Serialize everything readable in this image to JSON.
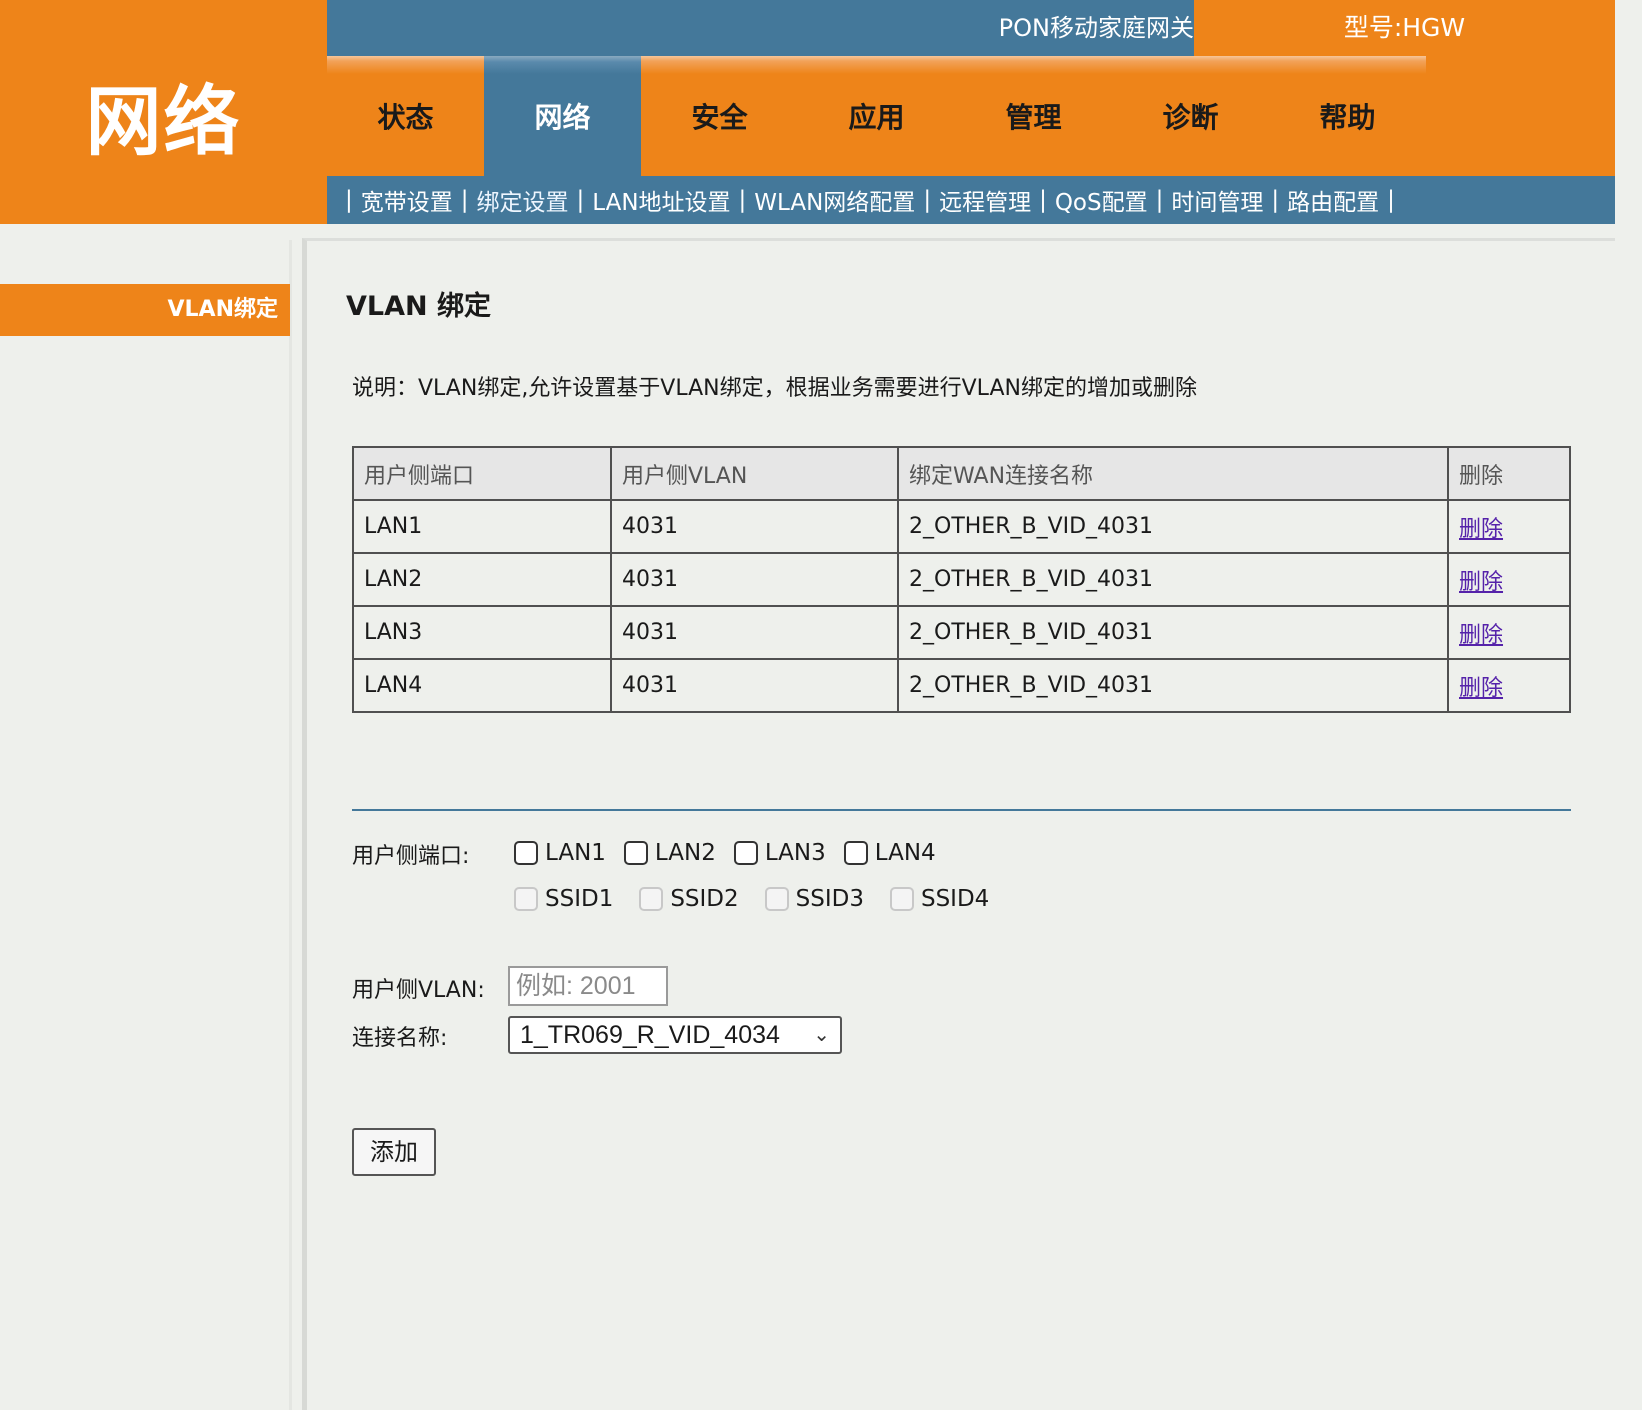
{
  "header": {
    "brand": "网络",
    "product": "PON移动家庭网关",
    "model": "型号:HGW"
  },
  "tabs": [
    {
      "label": "状态",
      "active": false
    },
    {
      "label": "网络",
      "active": true
    },
    {
      "label": "安全",
      "active": false
    },
    {
      "label": "应用",
      "active": false
    },
    {
      "label": "管理",
      "active": false
    },
    {
      "label": "诊断",
      "active": false
    },
    {
      "label": "帮助",
      "active": false
    }
  ],
  "subnav": {
    "separator": "|",
    "items": [
      "宽带设置",
      "绑定设置",
      "LAN地址设置",
      "WLAN网络配置",
      "远程管理",
      "QoS配置",
      "时间管理",
      "路由配置"
    ],
    "active_index": 1
  },
  "sidebar": {
    "items": [
      "VLAN绑定"
    ]
  },
  "main": {
    "title": "VLAN 绑定",
    "description": "说明：VLAN绑定,允许设置基于VLAN绑定，根据业务需要进行VLAN绑定的增加或删除",
    "table": {
      "headers": [
        "用户侧端口",
        "用户侧VLAN",
        "绑定WAN连接名称",
        "删除"
      ],
      "rows": [
        [
          "LAN1",
          "4031",
          "2_OTHER_B_VID_4031",
          "删除"
        ],
        [
          "LAN2",
          "4031",
          "2_OTHER_B_VID_4031",
          "删除"
        ],
        [
          "LAN3",
          "4031",
          "2_OTHER_B_VID_4031",
          "删除"
        ],
        [
          "LAN4",
          "4031",
          "2_OTHER_B_VID_4031",
          "删除"
        ]
      ]
    },
    "form": {
      "port_label": "用户侧端口:",
      "lan_ports": [
        "LAN1",
        "LAN2",
        "LAN3",
        "LAN4"
      ],
      "ssid_ports": [
        "SSID1",
        "SSID2",
        "SSID3",
        "SSID4"
      ],
      "vlan_label": "用户侧VLAN:",
      "vlan_placeholder": "例如: 2001",
      "conn_label": "连接名称:",
      "conn_value": "1_TR069_R_VID_4034",
      "add_label": "添加"
    }
  },
  "colors": {
    "orange": "#ee8419",
    "blue": "#44789a",
    "link": "#5522aa"
  }
}
